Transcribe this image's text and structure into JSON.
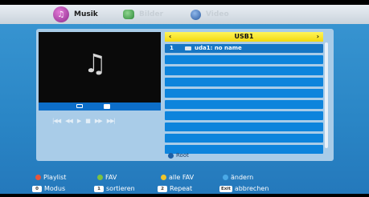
{
  "tabs": [
    {
      "label": "Musik",
      "icon": "music-note-icon"
    },
    {
      "label": "Bilder",
      "icon": "photo-icon"
    },
    {
      "label": "Video",
      "icon": "video-icon"
    }
  ],
  "preview": {
    "icon": "music-note-icon"
  },
  "controls": [
    "|◀◀",
    "◀◀",
    "▶",
    "■",
    "▶▶",
    "▶▶|"
  ],
  "list": {
    "title": "USB1",
    "items": [
      {
        "num": "1",
        "name": "uda1: no name"
      }
    ]
  },
  "root_label": "Root",
  "legend": {
    "playlist": "Playlist",
    "fav": "FAV",
    "alle_fav": "alle FAV",
    "aendern": "ändern",
    "modus_key": "0",
    "modus": "Modus",
    "sortieren_key": "1",
    "sortieren": "sortieren",
    "repeat_key": "2",
    "repeat": "Repeat",
    "exit_key": "Exit",
    "abbrechen": "abbrechen"
  },
  "colors": {
    "red": "#e8553b",
    "green": "#7cc242",
    "yellow": "#f0c52a",
    "blue": "#4aa9e6",
    "list_header": "#f6e03a"
  }
}
